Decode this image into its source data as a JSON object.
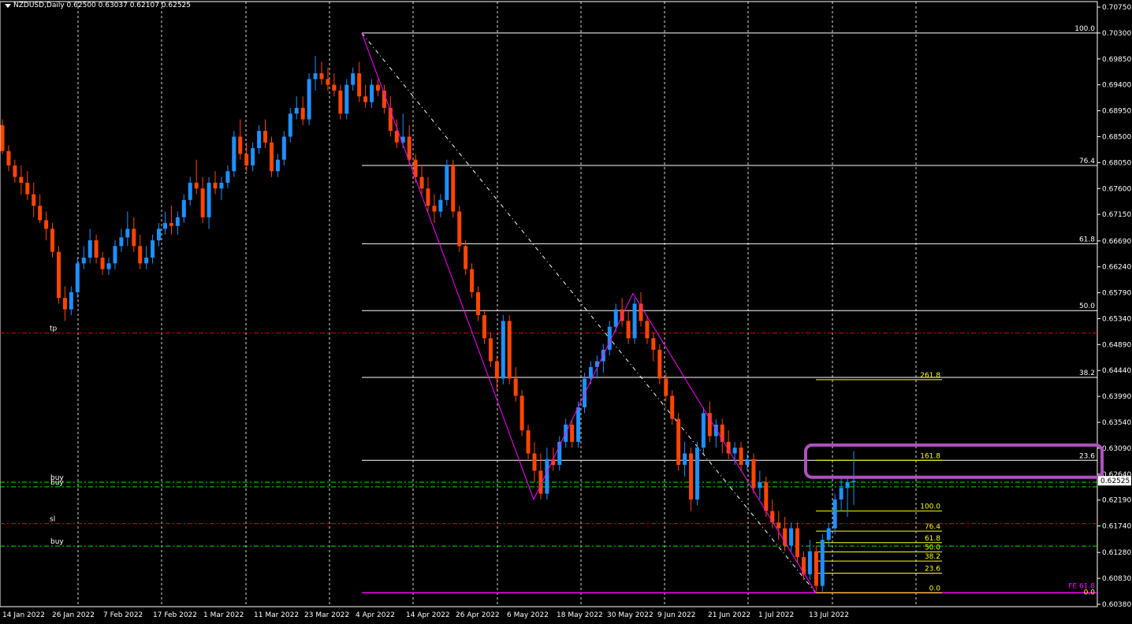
{
  "header": {
    "symbol_line": "NZDUSD,Daily  0.62500 0.63037 0.62107 0.62525"
  },
  "colors": {
    "background": "#000000",
    "bull": "#1e90ff",
    "bear": "#ff4500",
    "grid": "#ffffff",
    "axis_text": "#ffffff",
    "fib_main": "#ffffff",
    "fib_ext": "#ffff00",
    "zigzag": "#ff00ff",
    "tp_line": "#ff0000",
    "sl_line": "#ff0000",
    "buy_line": "#00ff00",
    "highlight_box": "#b050c0",
    "price_marker_bg": "#ffffff"
  },
  "chart_data": {
    "type": "candlestick",
    "symbol": "NZDUSD",
    "timeframe": "Daily",
    "ohlc_current": {
      "open": 0.625,
      "high": 0.63037,
      "low": 0.62107,
      "close": 0.62525
    },
    "ylim": [
      0.6038,
      0.7075
    ],
    "y_ticks": [
      "0.70750",
      "0.70300",
      "0.69850",
      "0.69400",
      "0.68950",
      "0.68500",
      "0.68050",
      "0.67600",
      "0.67150",
      "0.66690",
      "0.66240",
      "0.65790",
      "0.65340",
      "0.64890",
      "0.64440",
      "0.63990",
      "0.63540",
      "0.63090",
      "0.62640",
      "0.62190",
      "0.61740",
      "0.61280",
      "0.60830",
      "0.60380"
    ],
    "current_price_label": "0.62525",
    "x_ticks": [
      "14 Jan 2022",
      "26 Jan 2022",
      "7 Feb 2022",
      "17 Feb 2022",
      "1 Mar 2022",
      "11 Mar 2022",
      "23 Mar 2022",
      "4 Apr 2022",
      "14 Apr 2022",
      "26 Apr 2022",
      "6 May 2022",
      "18 May 2022",
      "30 May 2022",
      "9 Jun 2022",
      "21 Jun 2022",
      "1 Jul 2022",
      "13 Jul 2022"
    ],
    "candles": [
      [
        0.687,
        0.688,
        0.682,
        0.6825
      ],
      [
        0.6825,
        0.6835,
        0.679,
        0.68
      ],
      [
        0.68,
        0.681,
        0.677,
        0.678
      ],
      [
        0.678,
        0.68,
        0.675,
        0.677
      ],
      [
        0.677,
        0.679,
        0.674,
        0.675
      ],
      [
        0.675,
        0.677,
        0.671,
        0.673
      ],
      [
        0.673,
        0.675,
        0.67,
        0.6705
      ],
      [
        0.6705,
        0.672,
        0.667,
        0.669
      ],
      [
        0.669,
        0.67,
        0.664,
        0.665
      ],
      [
        0.665,
        0.666,
        0.656,
        0.657
      ],
      [
        0.657,
        0.659,
        0.653,
        0.655
      ],
      [
        0.655,
        0.659,
        0.654,
        0.658
      ],
      [
        0.658,
        0.664,
        0.657,
        0.663
      ],
      [
        0.663,
        0.666,
        0.662,
        0.664
      ],
      [
        0.664,
        0.669,
        0.663,
        0.667
      ],
      [
        0.667,
        0.668,
        0.663,
        0.664
      ],
      [
        0.664,
        0.665,
        0.661,
        0.662
      ],
      [
        0.662,
        0.664,
        0.661,
        0.663
      ],
      [
        0.663,
        0.667,
        0.662,
        0.666
      ],
      [
        0.666,
        0.669,
        0.665,
        0.6675
      ],
      [
        0.6675,
        0.672,
        0.666,
        0.669
      ],
      [
        0.669,
        0.671,
        0.665,
        0.666
      ],
      [
        0.666,
        0.668,
        0.662,
        0.663
      ],
      [
        0.663,
        0.666,
        0.662,
        0.664
      ],
      [
        0.664,
        0.668,
        0.663,
        0.667
      ],
      [
        0.667,
        0.67,
        0.666,
        0.669
      ],
      [
        0.669,
        0.672,
        0.668,
        0.67
      ],
      [
        0.67,
        0.673,
        0.668,
        0.6695
      ],
      [
        0.6695,
        0.672,
        0.668,
        0.671
      ],
      [
        0.671,
        0.675,
        0.67,
        0.674
      ],
      [
        0.674,
        0.678,
        0.673,
        0.677
      ],
      [
        0.677,
        0.681,
        0.675,
        0.676
      ],
      [
        0.676,
        0.678,
        0.67,
        0.671
      ],
      [
        0.671,
        0.678,
        0.669,
        0.677
      ],
      [
        0.677,
        0.679,
        0.675,
        0.676
      ],
      [
        0.676,
        0.678,
        0.674,
        0.677
      ],
      [
        0.677,
        0.68,
        0.676,
        0.679
      ],
      [
        0.679,
        0.686,
        0.678,
        0.685
      ],
      [
        0.685,
        0.688,
        0.681,
        0.682
      ],
      [
        0.682,
        0.684,
        0.679,
        0.68
      ],
      [
        0.68,
        0.684,
        0.679,
        0.683
      ],
      [
        0.683,
        0.687,
        0.682,
        0.686
      ],
      [
        0.686,
        0.688,
        0.683,
        0.684
      ],
      [
        0.684,
        0.685,
        0.678,
        0.679
      ],
      [
        0.679,
        0.682,
        0.678,
        0.681
      ],
      [
        0.681,
        0.686,
        0.68,
        0.685
      ],
      [
        0.685,
        0.69,
        0.684,
        0.689
      ],
      [
        0.689,
        0.692,
        0.688,
        0.69
      ],
      [
        0.69,
        0.692,
        0.687,
        0.688
      ],
      [
        0.688,
        0.696,
        0.687,
        0.695
      ],
      [
        0.695,
        0.699,
        0.693,
        0.696
      ],
      [
        0.696,
        0.698,
        0.694,
        0.695
      ],
      [
        0.695,
        0.697,
        0.693,
        0.694
      ],
      [
        0.694,
        0.696,
        0.692,
        0.693
      ],
      [
        0.693,
        0.694,
        0.688,
        0.689
      ],
      [
        0.689,
        0.695,
        0.688,
        0.694
      ],
      [
        0.694,
        0.697,
        0.693,
        0.696
      ],
      [
        0.696,
        0.698,
        0.691,
        0.692
      ],
      [
        0.692,
        0.694,
        0.69,
        0.691
      ],
      [
        0.691,
        0.695,
        0.69,
        0.694
      ],
      [
        0.694,
        0.695,
        0.692,
        0.693
      ],
      [
        0.693,
        0.694,
        0.689,
        0.69
      ],
      [
        0.69,
        0.692,
        0.685,
        0.686
      ],
      [
        0.686,
        0.688,
        0.683,
        0.684
      ],
      [
        0.684,
        0.689,
        0.683,
        0.685
      ],
      [
        0.685,
        0.687,
        0.68,
        0.681
      ],
      [
        0.681,
        0.682,
        0.677,
        0.678
      ],
      [
        0.678,
        0.68,
        0.675,
        0.676
      ],
      [
        0.676,
        0.678,
        0.672,
        0.673
      ],
      [
        0.673,
        0.675,
        0.67,
        0.672
      ],
      [
        0.672,
        0.675,
        0.671,
        0.674
      ],
      [
        0.674,
        0.681,
        0.673,
        0.68
      ],
      [
        0.68,
        0.681,
        0.671,
        0.672
      ],
      [
        0.672,
        0.673,
        0.665,
        0.666
      ],
      [
        0.666,
        0.667,
        0.661,
        0.662
      ],
      [
        0.662,
        0.663,
        0.657,
        0.658
      ],
      [
        0.658,
        0.659,
        0.653,
        0.654
      ],
      [
        0.654,
        0.655,
        0.649,
        0.65
      ],
      [
        0.65,
        0.651,
        0.645,
        0.646
      ],
      [
        0.646,
        0.647,
        0.641,
        0.643
      ],
      [
        0.643,
        0.654,
        0.642,
        0.653
      ],
      [
        0.653,
        0.654,
        0.642,
        0.643
      ],
      [
        0.643,
        0.645,
        0.639,
        0.64
      ],
      [
        0.64,
        0.641,
        0.633,
        0.634
      ],
      [
        0.634,
        0.635,
        0.629,
        0.63
      ],
      [
        0.63,
        0.632,
        0.625,
        0.627
      ],
      [
        0.627,
        0.63,
        0.622,
        0.623
      ],
      [
        0.623,
        0.631,
        0.622,
        0.629
      ],
      [
        0.629,
        0.631,
        0.627,
        0.628
      ],
      [
        0.628,
        0.633,
        0.627,
        0.632
      ],
      [
        0.632,
        0.636,
        0.631,
        0.635
      ],
      [
        0.635,
        0.636,
        0.631,
        0.632
      ],
      [
        0.632,
        0.639,
        0.631,
        0.638
      ],
      [
        0.638,
        0.644,
        0.637,
        0.643
      ],
      [
        0.643,
        0.646,
        0.642,
        0.645
      ],
      [
        0.645,
        0.647,
        0.643,
        0.646
      ],
      [
        0.646,
        0.649,
        0.644,
        0.648
      ],
      [
        0.648,
        0.653,
        0.647,
        0.652
      ],
      [
        0.652,
        0.656,
        0.651,
        0.655
      ],
      [
        0.655,
        0.657,
        0.652,
        0.653
      ],
      [
        0.653,
        0.655,
        0.649,
        0.65
      ],
      [
        0.65,
        0.657,
        0.649,
        0.656
      ],
      [
        0.656,
        0.658,
        0.652,
        0.653
      ],
      [
        0.653,
        0.654,
        0.649,
        0.65
      ],
      [
        0.65,
        0.651,
        0.646,
        0.648
      ],
      [
        0.648,
        0.649,
        0.642,
        0.643
      ],
      [
        0.643,
        0.644,
        0.639,
        0.64
      ],
      [
        0.64,
        0.641,
        0.635,
        0.636
      ],
      [
        0.636,
        0.637,
        0.627,
        0.628
      ],
      [
        0.628,
        0.632,
        0.626,
        0.63
      ],
      [
        0.63,
        0.631,
        0.62,
        0.622
      ],
      [
        0.622,
        0.632,
        0.621,
        0.631
      ],
      [
        0.631,
        0.638,
        0.63,
        0.637
      ],
      [
        0.637,
        0.639,
        0.632,
        0.633
      ],
      [
        0.633,
        0.636,
        0.631,
        0.635
      ],
      [
        0.635,
        0.636,
        0.63,
        0.632
      ],
      [
        0.632,
        0.634,
        0.629,
        0.63
      ],
      [
        0.63,
        0.632,
        0.628,
        0.631
      ],
      [
        0.631,
        0.632,
        0.627,
        0.628
      ],
      [
        0.628,
        0.63,
        0.627,
        0.629
      ],
      [
        0.629,
        0.63,
        0.623,
        0.624
      ],
      [
        0.624,
        0.627,
        0.622,
        0.625
      ],
      [
        0.625,
        0.626,
        0.619,
        0.62
      ],
      [
        0.62,
        0.622,
        0.617,
        0.618
      ],
      [
        0.618,
        0.62,
        0.615,
        0.617
      ],
      [
        0.617,
        0.619,
        0.613,
        0.614
      ],
      [
        0.614,
        0.618,
        0.613,
        0.617
      ],
      [
        0.617,
        0.618,
        0.611,
        0.612
      ],
      [
        0.612,
        0.613,
        0.608,
        0.609
      ],
      [
        0.609,
        0.615,
        0.608,
        0.613
      ],
      [
        0.613,
        0.614,
        0.606,
        0.607
      ],
      [
        0.607,
        0.616,
        0.606,
        0.615
      ],
      [
        0.615,
        0.618,
        0.614,
        0.617
      ],
      [
        0.617,
        0.623,
        0.616,
        0.622
      ],
      [
        0.622,
        0.626,
        0.62,
        0.624
      ],
      [
        0.624,
        0.626,
        0.619,
        0.625
      ],
      [
        0.625,
        0.63037,
        0.62107,
        0.62525
      ]
    ],
    "fibonacci_retracement": {
      "high": 0.703,
      "low": 0.6058,
      "levels": [
        {
          "label": "100.0",
          "price": 0.703
        },
        {
          "label": "76.4",
          "price": 0.68
        },
        {
          "label": "61.8",
          "price": 0.6664
        },
        {
          "label": "50.0",
          "price": 0.6548
        },
        {
          "label": "38.2",
          "price": 0.6432
        },
        {
          "label": "23.6",
          "price": 0.6288
        },
        {
          "label": "0.0",
          "price": 0.6058
        }
      ]
    },
    "fibonacci_extension": {
      "levels": [
        {
          "label": "261.8",
          "price": 0.6428
        },
        {
          "label": "161.8",
          "price": 0.6288
        },
        {
          "label": "100.0",
          "price": 0.62
        },
        {
          "label": "76.4",
          "price": 0.6165
        },
        {
          "label": "61.8",
          "price": 0.6145
        },
        {
          "label": "50.0",
          "price": 0.6129
        },
        {
          "label": "38.2",
          "price": 0.6113
        },
        {
          "label": "23.6",
          "price": 0.6092
        },
        {
          "label": "0.0",
          "price": 0.6058
        }
      ]
    },
    "fe_label": "FE 61.8",
    "zigzag_points": [
      {
        "date": "4 Apr 2022",
        "price": 0.703
      },
      {
        "date": "6 May 2022",
        "price": 0.622
      },
      {
        "date": "30 May 2022",
        "price": 0.6578
      },
      {
        "date": "13 Jul 2022",
        "price": 0.6058
      }
    ],
    "horizontal_lines": [
      {
        "label": "tp",
        "price": 0.6509,
        "kind": "tp"
      },
      {
        "label": "buy",
        "price": 0.625,
        "kind": "buy"
      },
      {
        "label": "buy",
        "price": 0.6242,
        "kind": "buy"
      },
      {
        "label": "sl",
        "price": 0.6178,
        "kind": "sl"
      },
      {
        "label": "buy",
        "price": 0.6139,
        "kind": "buy"
      }
    ],
    "highlight_zone": {
      "price_top": 0.6309,
      "price_bottom": 0.6264
    },
    "grid": true,
    "legend": "none"
  }
}
